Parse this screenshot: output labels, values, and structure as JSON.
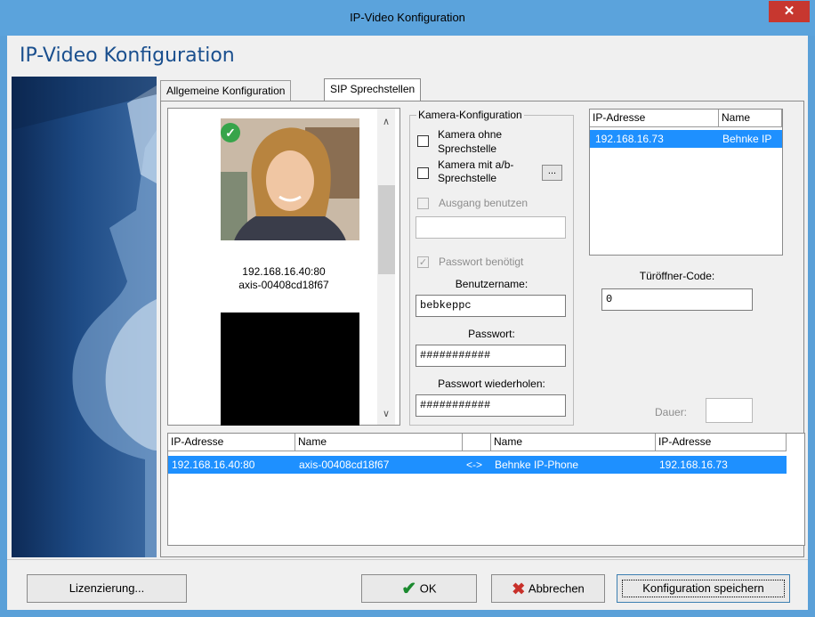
{
  "window": {
    "title": "IP-Video Konfiguration",
    "close_glyph": "✕"
  },
  "header": {
    "title": "IP-Video Konfiguration"
  },
  "tabs": [
    {
      "label": "Allgemeine Konfiguration",
      "active": false
    },
    {
      "label": "SIP Sprechstellen",
      "active": true
    }
  ],
  "camera_list": {
    "items": [
      {
        "ip": "192.168.16.40:80",
        "name": "axis-00408cd18f67",
        "status_icon": "check-icon"
      }
    ]
  },
  "kamera_konfig": {
    "group_title": "Kamera-Konfiguration",
    "ohne_label": "Kamera ohne Sprechstelle",
    "mit_label": "Kamera mit a/b-Sprechstelle",
    "mit_button": "...",
    "ausgang_label": "Ausgang benutzen",
    "ausgang_value": "",
    "passwort_benoetigt_label": "Passwort benötigt",
    "benutzername_label": "Benutzername:",
    "benutzername_value": "bebkeppc",
    "passwort_label": "Passwort:",
    "passwort_value": "###########",
    "passwort_wdh_label": "Passwort wiederholen:",
    "passwort_wdh_value": "###########"
  },
  "sip_list": {
    "headers": [
      "IP-Adresse",
      "Name"
    ],
    "rows": [
      {
        "ip": "192.168.16.73",
        "name": "Behnke IP"
      }
    ]
  },
  "tueroeffner": {
    "label": "Türöffner-Code:",
    "value": "0"
  },
  "dauer": {
    "label": "Dauer:",
    "value": ""
  },
  "mapping_table": {
    "headers": [
      "IP-Adresse",
      "Name",
      "",
      "Name",
      "IP-Adresse"
    ],
    "rows": [
      {
        "ip1": "192.168.16.40:80",
        "name1": "axis-00408cd18f67",
        "link": "<->",
        "name2": "Behnke IP-Phone",
        "ip2": "192.168.16.73"
      }
    ]
  },
  "footer": {
    "lizenz": "Lizenzierung...",
    "ok": "OK",
    "abbrechen": "Abbrechen",
    "speichern": "Konfiguration speichern"
  },
  "colors": {
    "accent": "#1e90ff",
    "title_bar": "#5ba3dc",
    "close": "#c7372f",
    "header_text": "#1a4f8e"
  }
}
